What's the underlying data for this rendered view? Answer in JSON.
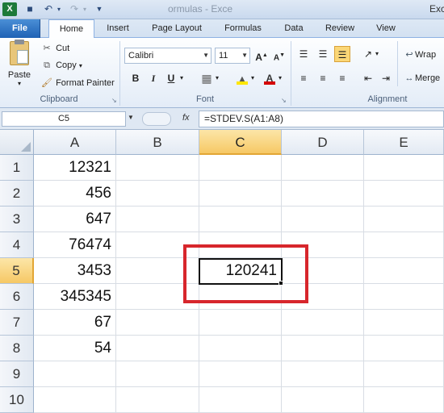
{
  "titlebar": {
    "app_icon": "excel-icon",
    "doc_title": "ormulas - Exce",
    "app_name_partial": "Exc"
  },
  "tabs": [
    {
      "label": "File"
    },
    {
      "label": "Home"
    },
    {
      "label": "Insert"
    },
    {
      "label": "Page Layout"
    },
    {
      "label": "Formulas"
    },
    {
      "label": "Data"
    },
    {
      "label": "Review"
    },
    {
      "label": "View"
    }
  ],
  "clipboard": {
    "group_label": "Clipboard",
    "paste": "Paste",
    "cut": "Cut",
    "copy": "Copy",
    "format_painter": "Format Painter"
  },
  "font": {
    "group_label": "Font",
    "name": "Calibri",
    "size": "11",
    "bold": "B",
    "italic": "I",
    "underline": "U"
  },
  "alignment": {
    "group_label": "Alignment",
    "wrap": "Wrap",
    "merge": "Merge"
  },
  "formula_bar": {
    "name_box": "C5",
    "fx": "fx",
    "formula": "=STDEV.S(A1:A8)"
  },
  "grid": {
    "columns": [
      "A",
      "B",
      "C",
      "D",
      "E"
    ],
    "selected_column": "C",
    "rows": [
      "1",
      "2",
      "3",
      "4",
      "5",
      "6",
      "7",
      "8",
      "9",
      "10"
    ],
    "selected_row": "5",
    "col_a_values": [
      "12321",
      "456",
      "647",
      "76474",
      "3453",
      "345345",
      "67",
      "54"
    ],
    "c5_value": "120241"
  },
  "colors": {
    "highlight": "#d7262c",
    "selection": "#f6c865",
    "file_tab": "#1f62b5"
  }
}
